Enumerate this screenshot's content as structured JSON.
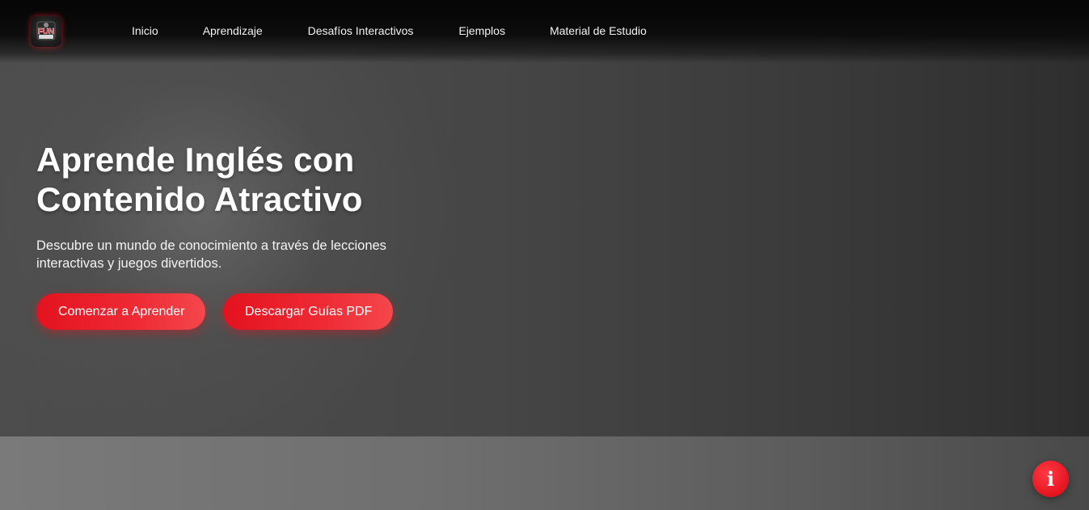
{
  "navbar": {
    "logo": {
      "icon": "fun-english-logo-icon",
      "text": "FUN"
    },
    "links": [
      {
        "label": "Inicio"
      },
      {
        "label": "Aprendizaje"
      },
      {
        "label": "Desafíos Interactivos"
      },
      {
        "label": "Ejemplos"
      },
      {
        "label": "Material de Estudio"
      }
    ]
  },
  "hero": {
    "title": "Aprende Inglés con Contenido Atractivo",
    "subtitle": "Descubre un mundo de conocimiento a través de lecciones interactivas y juegos divertidos.",
    "buttons": {
      "primary_label": "Comenzar a Aprender",
      "secondary_label": "Descargar Guías PDF"
    }
  },
  "floating": {
    "info_button": {
      "icon": "info-icon",
      "glyph": "i"
    }
  },
  "colors": {
    "accent": "#e3121f",
    "navbar_bg": "#050505",
    "hero_bg": "#464646",
    "text_light": "#ffffff"
  }
}
